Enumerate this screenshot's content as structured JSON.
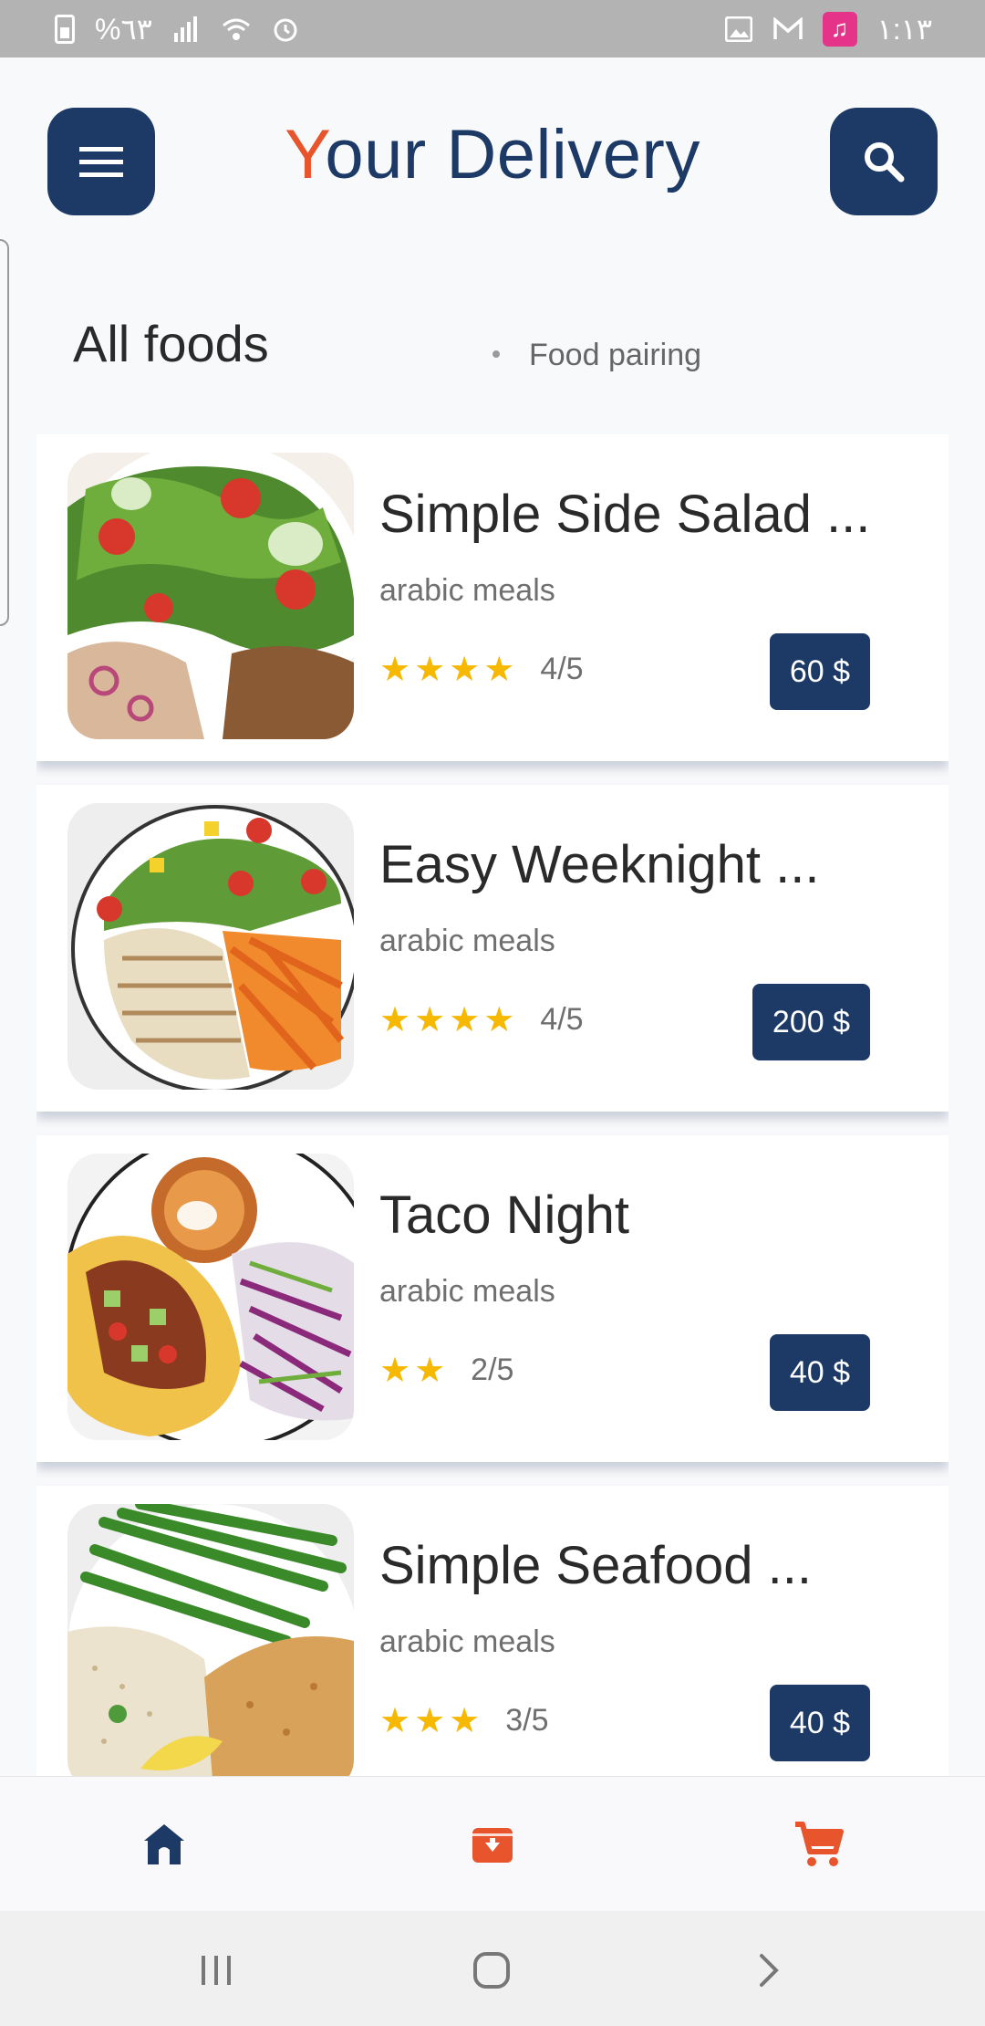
{
  "status_bar": {
    "battery_text": "%٦٣",
    "time": "١:١٣",
    "icons": [
      "battery-icon",
      "signal-icon",
      "wifi-icon",
      "alarm-icon",
      "image-icon",
      "gmail-icon",
      "music-icon"
    ]
  },
  "header": {
    "title_first_letter": "Y",
    "title_rest": "our Delivery",
    "menu_icon": "menu-icon",
    "search_icon": "search-icon"
  },
  "tabs": {
    "active": "All foods",
    "secondary": "Food pairing"
  },
  "foods": [
    {
      "name": "Simple Side Salad ...",
      "category": "arabic meals",
      "stars": 4,
      "rating": "4/5",
      "price": "60 $",
      "image": "salad-plate"
    },
    {
      "name": "Easy Weeknight ...",
      "category": "arabic meals",
      "stars": 4,
      "rating": "4/5",
      "price": "200 $",
      "image": "chicken-plate"
    },
    {
      "name": "Taco Night",
      "category": "arabic meals",
      "stars": 2,
      "rating": "2/5",
      "price": "40 $",
      "image": "taco-plate"
    },
    {
      "name": "Simple Seafood ...",
      "category": "arabic meals",
      "stars": 3,
      "rating": "3/5",
      "price": "40 $",
      "image": "seafood-plate"
    }
  ],
  "bottom_nav": {
    "items": [
      "home-icon",
      "archive-icon",
      "cart-icon"
    ],
    "colors": {
      "home": "#1d3a66",
      "accent": "#e8542b"
    }
  },
  "system_nav": [
    "recents-icon",
    "home-circle-icon",
    "back-icon"
  ],
  "colors": {
    "primary": "#1d3a66",
    "accent": "#e8542b",
    "star": "#f6b800"
  }
}
